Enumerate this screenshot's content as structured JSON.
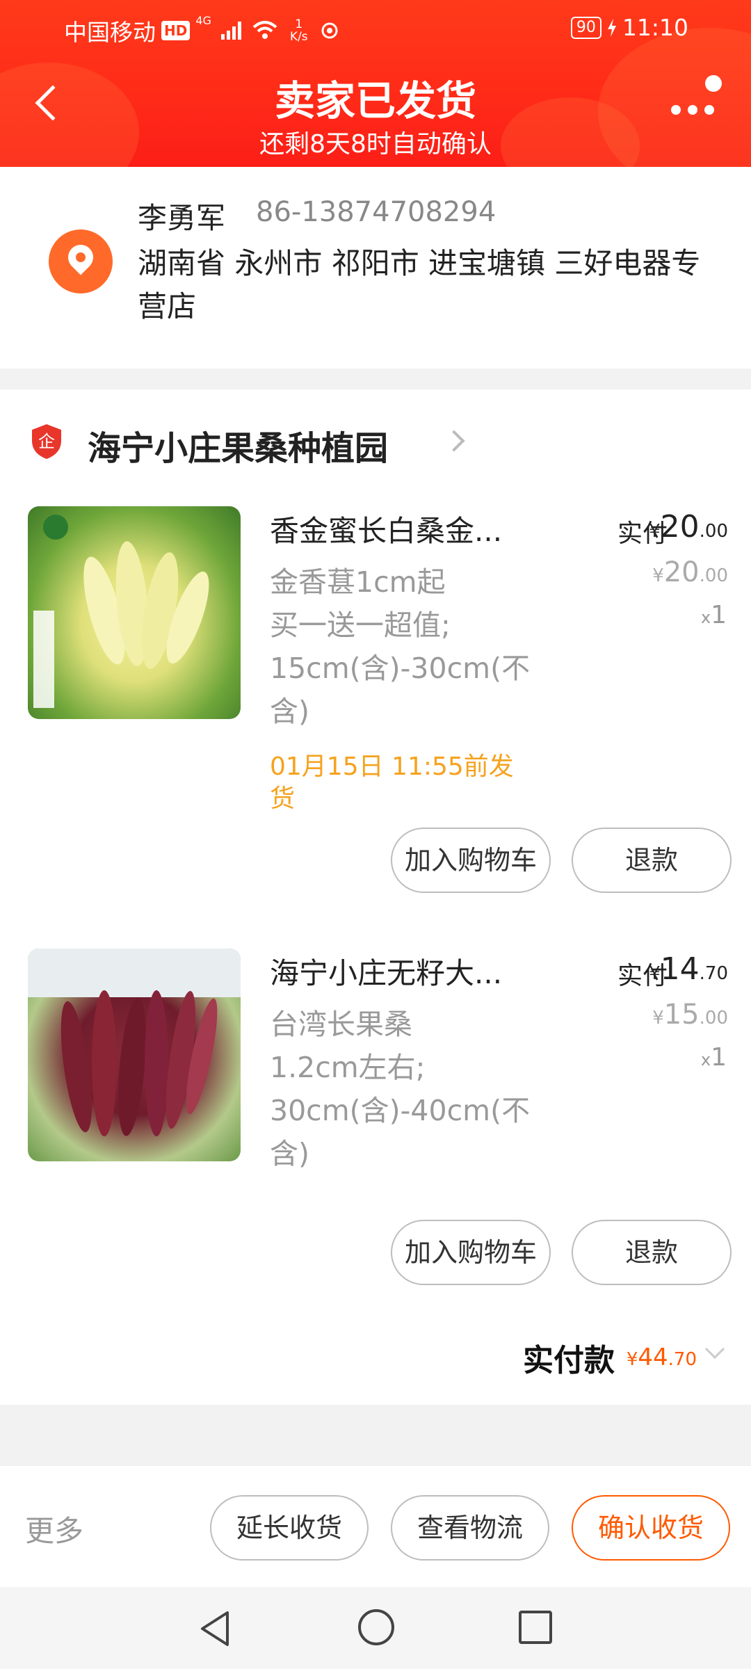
{
  "status_bar": {
    "carrier": "中国移动",
    "hd": "HD",
    "network": "4G",
    "speed_value": "1",
    "speed_unit": "K/s",
    "battery": "90",
    "time": "11:10"
  },
  "header": {
    "title": "卖家已发货",
    "subtitle": "还剩8天8时自动确认"
  },
  "address": {
    "name": "李勇军",
    "phone": "86-13874708294",
    "full": "湖南省 永州市 祁阳市 进宝塘镇 三好电器专营店"
  },
  "store": {
    "badge_char": "企",
    "name": "海宁小庄果桑种植园"
  },
  "items": [
    {
      "title": "香金蜜长白桑金...",
      "spec_lines": [
        "金香葚1cm起",
        "买一送一超值;",
        "15cm(含)-30cm(不",
        "含)"
      ],
      "ship_lines": [
        "01月15日 11:55前发",
        "货"
      ],
      "paid_label": "实付",
      "paid_currency": "¥",
      "paid_int": "20",
      "paid_dec": ".00",
      "orig_currency": "¥",
      "orig_int": "20",
      "orig_dec": ".00",
      "qty_x": "x",
      "qty": "1",
      "add_cart": "加入购物车",
      "refund": "退款"
    },
    {
      "title": "海宁小庄无籽大...",
      "spec_lines": [
        "台湾长果桑",
        "1.2cm左右;",
        "30cm(含)-40cm(不",
        "含)"
      ],
      "paid_label": "实付",
      "paid_currency": "¥",
      "paid_int": "14",
      "paid_dec": ".70",
      "orig_currency": "¥",
      "orig_int": "15",
      "orig_dec": ".00",
      "qty_x": "x",
      "qty": "1",
      "add_cart": "加入购物车",
      "refund": "退款"
    }
  ],
  "total": {
    "label": "实付款",
    "currency": "¥",
    "int": "44",
    "dec": ".70"
  },
  "bottom": {
    "more": "更多",
    "extend": "延长收货",
    "logistics": "查看物流",
    "confirm": "确认收货"
  },
  "colors": {
    "header_red": "#ff2a18",
    "accent_orange": "#ff5a00",
    "ship_orange": "#f5a21e"
  }
}
